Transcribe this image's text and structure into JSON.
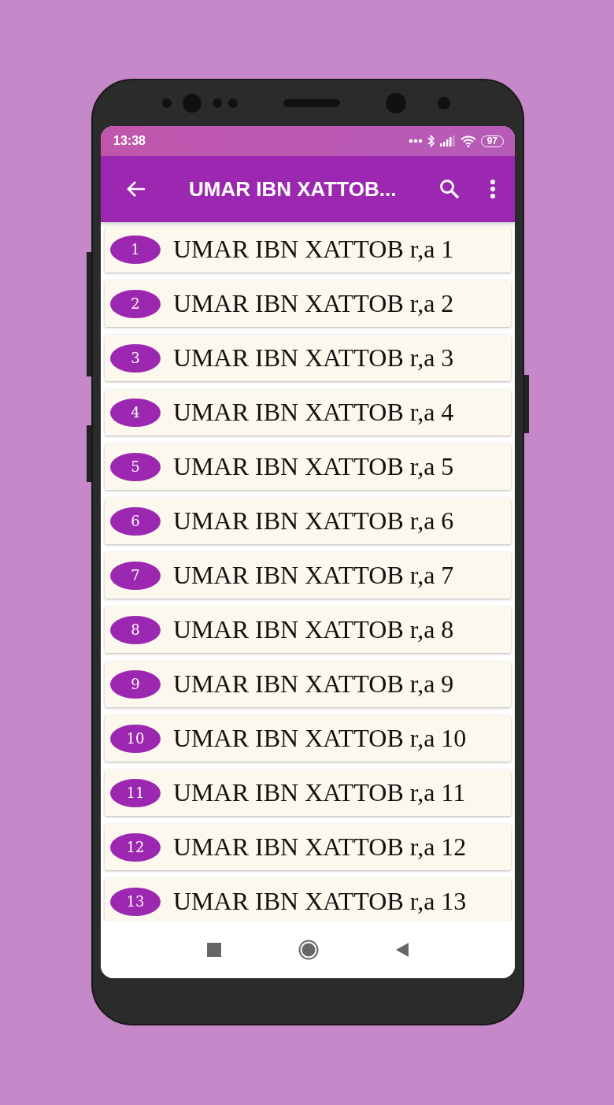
{
  "status_bar": {
    "time": "13:38",
    "battery": "97"
  },
  "app_bar": {
    "title": "UMAR IBN XATTOB..."
  },
  "items": [
    {
      "number": "1",
      "title": "UMAR IBN XATTOB r,a 1"
    },
    {
      "number": "2",
      "title": "UMAR IBN XATTOB r,a 2"
    },
    {
      "number": "3",
      "title": "UMAR IBN XATTOB r,a 3"
    },
    {
      "number": "4",
      "title": "UMAR IBN XATTOB r,a 4"
    },
    {
      "number": "5",
      "title": "UMAR IBN XATTOB r,a 5"
    },
    {
      "number": "6",
      "title": "UMAR IBN XATTOB r,a 6"
    },
    {
      "number": "7",
      "title": "UMAR IBN XATTOB r,a 7"
    },
    {
      "number": "8",
      "title": "UMAR IBN XATTOB r,a 8"
    },
    {
      "number": "9",
      "title": "UMAR IBN XATTOB r,a 9"
    },
    {
      "number": "10",
      "title": "UMAR IBN XATTOB r,a 10"
    },
    {
      "number": "11",
      "title": "UMAR IBN XATTOB r,a 11"
    },
    {
      "number": "12",
      "title": "UMAR IBN XATTOB r,a 12"
    },
    {
      "number": "13",
      "title": "UMAR IBN XATTOB r,a 13"
    }
  ]
}
